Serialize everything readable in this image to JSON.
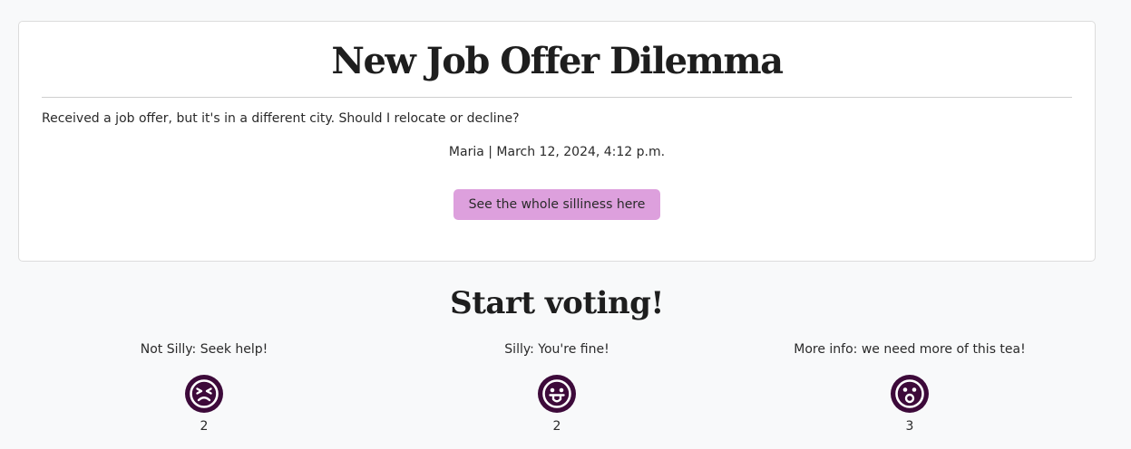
{
  "post": {
    "title": "New Job Offer Dilemma",
    "body": "Received a job offer, but it's in a different city. Should I relocate or decline?",
    "meta": "Maria | March 12, 2024, 4:12 p.m.",
    "button_label": "See the whole silliness here"
  },
  "voting": {
    "heading": "Start voting!",
    "options": [
      {
        "label": "Not Silly: Seek help!",
        "icon": "tired-face-icon",
        "count": "2"
      },
      {
        "label": "Silly: You're fine!",
        "icon": "tongue-face-icon",
        "count": "2"
      },
      {
        "label": "More info: we need more of this tea!",
        "icon": "surprised-face-icon",
        "count": "3"
      }
    ]
  },
  "colors": {
    "button_bg": "#dda0dd",
    "emoji_bg": "#3d0a3a",
    "page_bg": "#f8f9fa"
  }
}
